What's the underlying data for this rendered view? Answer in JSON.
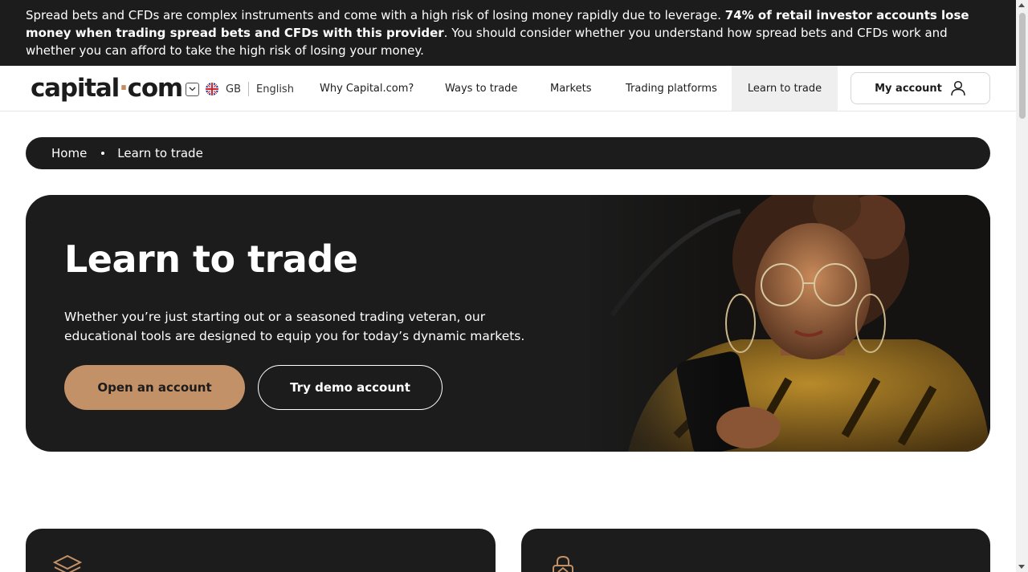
{
  "risk_warning": {
    "text_part1": "Spread bets and CFDs are complex instruments and come with a high risk of losing money rapidly due to leverage. ",
    "bold_text": "74% of retail investor accounts lose money when trading spread bets and CFDs with this provider",
    "text_part2": ". You should consider whether you understand how spread bets and CFDs work and whether you can afford to take the high risk of losing your money."
  },
  "header": {
    "logo_left": "capital",
    "logo_dot": "·",
    "logo_right": "com",
    "region": "GB",
    "language": "English",
    "nav": [
      {
        "label": "Why Capital.com?"
      },
      {
        "label": "Ways to trade"
      },
      {
        "label": "Markets"
      },
      {
        "label": "Trading platforms"
      },
      {
        "label": "Learn to trade",
        "active": true
      }
    ],
    "account_label": "My account"
  },
  "breadcrumb": {
    "home": "Home",
    "current": "Learn to trade"
  },
  "hero": {
    "title": "Learn to trade",
    "subtitle": "Whether you’re just starting out or a seasoned trading veteran, our educational tools are designed to equip you for today’s dynamic markets.",
    "primary_cta": "Open an account",
    "secondary_cta": "Try demo account"
  },
  "colors": {
    "dark": "#1c1c1c",
    "accent": "#c39167",
    "active_nav_bg": "#efefef"
  },
  "icons": [
    "chevron-down-icon",
    "uk-flag-icon",
    "user-icon",
    "stack-icon",
    "lock-icon"
  ]
}
